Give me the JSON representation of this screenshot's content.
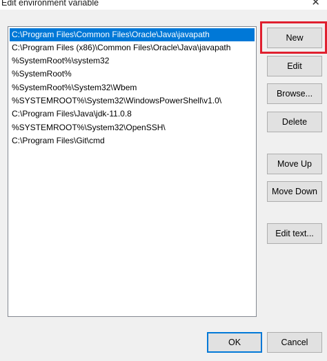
{
  "window": {
    "title": "Edit environment variable",
    "close_glyph": "✕"
  },
  "paths": [
    "C:\\Program Files\\Common Files\\Oracle\\Java\\javapath",
    "C:\\Program Files (x86)\\Common Files\\Oracle\\Java\\javapath",
    "%SystemRoot%\\system32",
    "%SystemRoot%",
    "%SystemRoot%\\System32\\Wbem",
    "%SYSTEMROOT%\\System32\\WindowsPowerShell\\v1.0\\",
    "C:\\Program Files\\Java\\jdk-11.0.8",
    "%SYSTEMROOT%\\System32\\OpenSSH\\",
    "C:\\Program Files\\Git\\cmd"
  ],
  "selected_index": 0,
  "buttons": {
    "new": "New",
    "edit": "Edit",
    "browse": "Browse...",
    "delete": "Delete",
    "move_up": "Move Up",
    "move_down": "Move Down",
    "edit_text": "Edit text...",
    "ok": "OK",
    "cancel": "Cancel"
  },
  "colors": {
    "selection": "#0078d7",
    "highlight_box": "#e0202f"
  }
}
